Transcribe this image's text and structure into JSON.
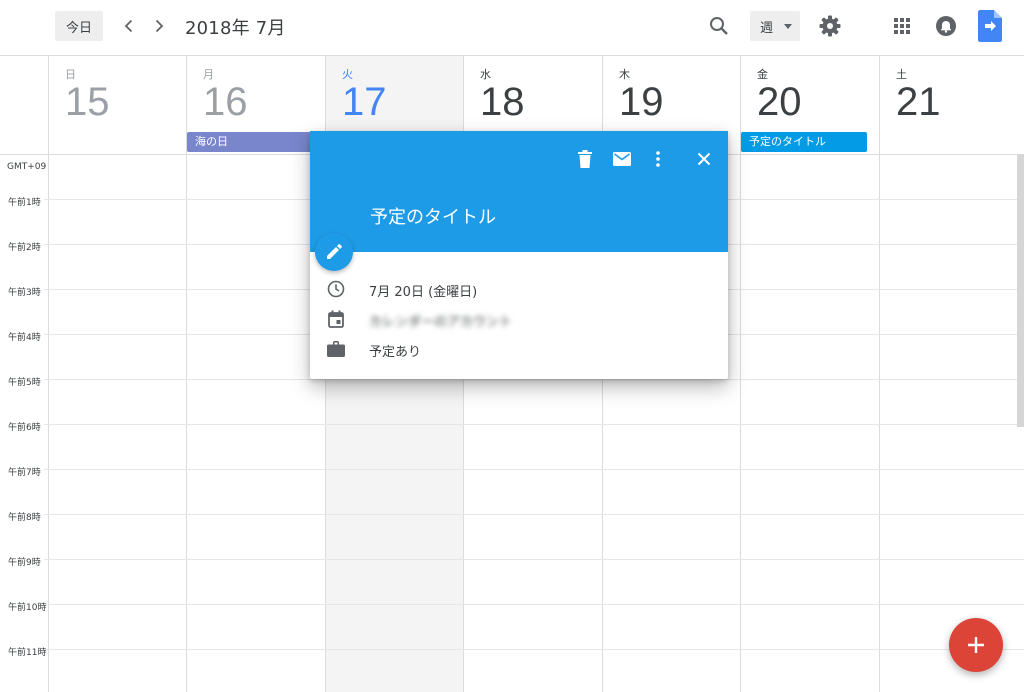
{
  "toolbar": {
    "today_label": "今日",
    "month_title": "2018年 7月",
    "view_label": "週"
  },
  "timezone": "GMT+09",
  "days": [
    {
      "dow": "日",
      "date": "15",
      "state": "past"
    },
    {
      "dow": "月",
      "date": "16",
      "state": "past"
    },
    {
      "dow": "火",
      "date": "17",
      "state": "today"
    },
    {
      "dow": "水",
      "date": "18",
      "state": "future"
    },
    {
      "dow": "木",
      "date": "19",
      "state": "future"
    },
    {
      "dow": "金",
      "date": "20",
      "state": "future"
    },
    {
      "dow": "土",
      "date": "21",
      "state": "future"
    }
  ],
  "allday_events": [
    {
      "label": "海の日",
      "color": "#7986cb"
    },
    {
      "label": "予定のタイトル",
      "color": "#039be5"
    }
  ],
  "time_labels": [
    "午前1時",
    "午前2時",
    "午前3時",
    "午前4時",
    "午前5時",
    "午前6時",
    "午前7時",
    "午前8時",
    "午前9時",
    "午前10時",
    "午前11時"
  ],
  "popup": {
    "title": "予定のタイトル",
    "date_text": "7月 20日 (金曜日)",
    "calendar_text": "カレンダーのアカウント",
    "status_text": "予定あり",
    "header_color": "#1e9be6"
  },
  "colors": {
    "accent": "#4285f4",
    "fab": "#db4437"
  }
}
